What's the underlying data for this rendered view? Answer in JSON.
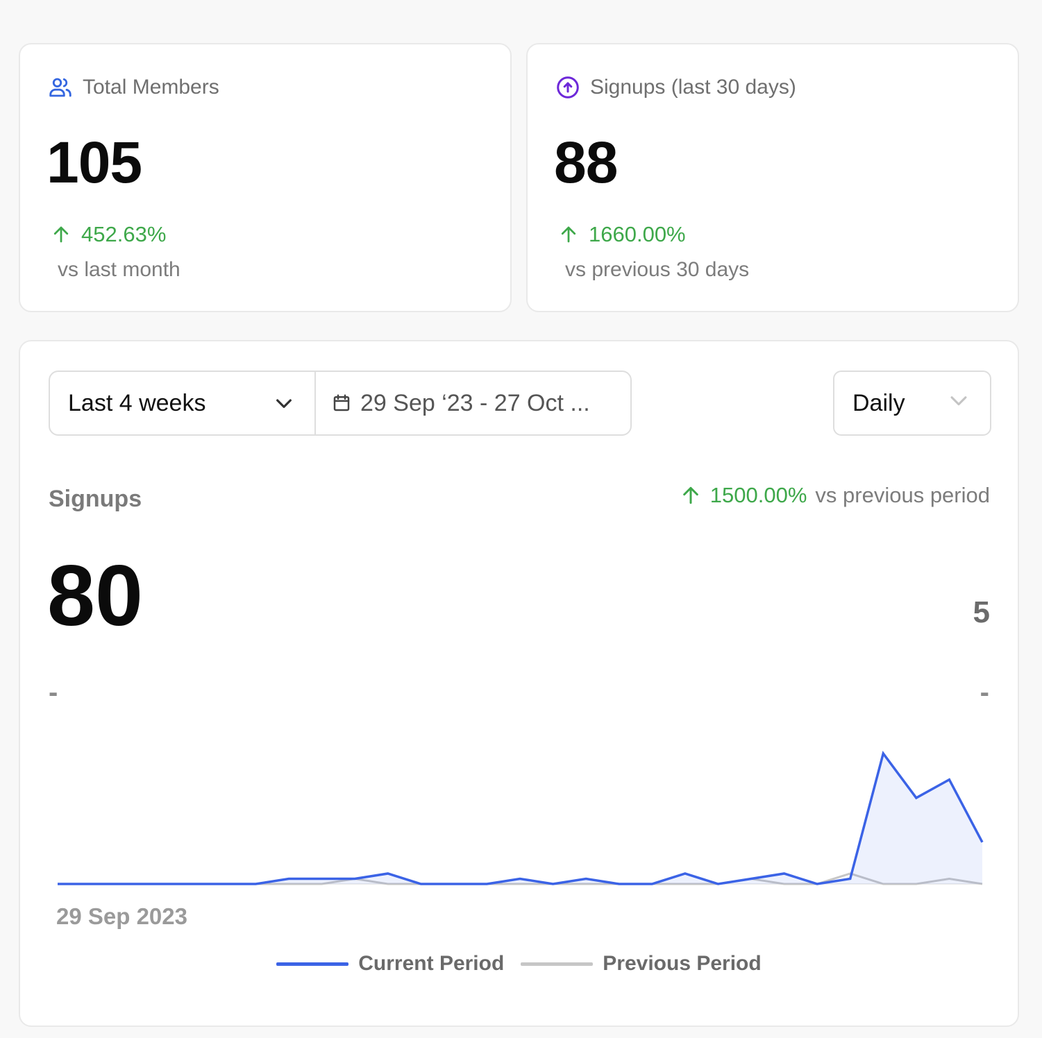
{
  "page": {
    "top_cut_text": ""
  },
  "stats": [
    {
      "title": "Total Members",
      "icon": "users-icon",
      "value": "105",
      "change": "452.63%",
      "comparison": "vs last month"
    },
    {
      "title": "Signups (last 30 days)",
      "icon": "arrow-up-circle-icon",
      "value": "88",
      "change": "1660.00%",
      "comparison": "vs previous 30 days"
    }
  ],
  "filters": {
    "range_label": "Last 4 weeks",
    "date_range": "29 Sep ‘23 - 27 Oct ...",
    "interval_label": "Daily"
  },
  "metric": {
    "label": "Signups",
    "value": "80",
    "change": "1500.00%",
    "comparison": "vs previous period",
    "peak_label": "5",
    "left_dash": "-",
    "right_dash": "-",
    "x_start_label": "29 Sep 2023"
  },
  "colors": {
    "current": "#3b63e6",
    "previous": "#c6c6c6",
    "positive": "#3ea84a",
    "members_icon": "#3466e0",
    "signups_icon": "#6d28d9"
  },
  "chart_data": {
    "type": "line",
    "xlabel": "",
    "ylabel": "",
    "ylim": [
      0,
      5
    ],
    "x_start": "29 Sep 2023",
    "series": [
      {
        "name": "Current Period",
        "values": [
          0,
          0,
          0,
          0,
          0,
          0,
          0,
          0.2,
          0.2,
          0.2,
          0.4,
          0,
          0,
          0,
          0.2,
          0,
          0.2,
          0,
          0,
          0.4,
          0,
          0.2,
          0.4,
          0,
          0.2,
          5,
          3.3,
          4,
          1.6
        ]
      },
      {
        "name": "Previous Period",
        "values": [
          0,
          0,
          0,
          0,
          0,
          0,
          0,
          0,
          0,
          0.2,
          0,
          0,
          0,
          0,
          0,
          0,
          0,
          0,
          0,
          0,
          0,
          0.2,
          0,
          0,
          0.4,
          0,
          0,
          0.2,
          0
        ]
      }
    ]
  }
}
